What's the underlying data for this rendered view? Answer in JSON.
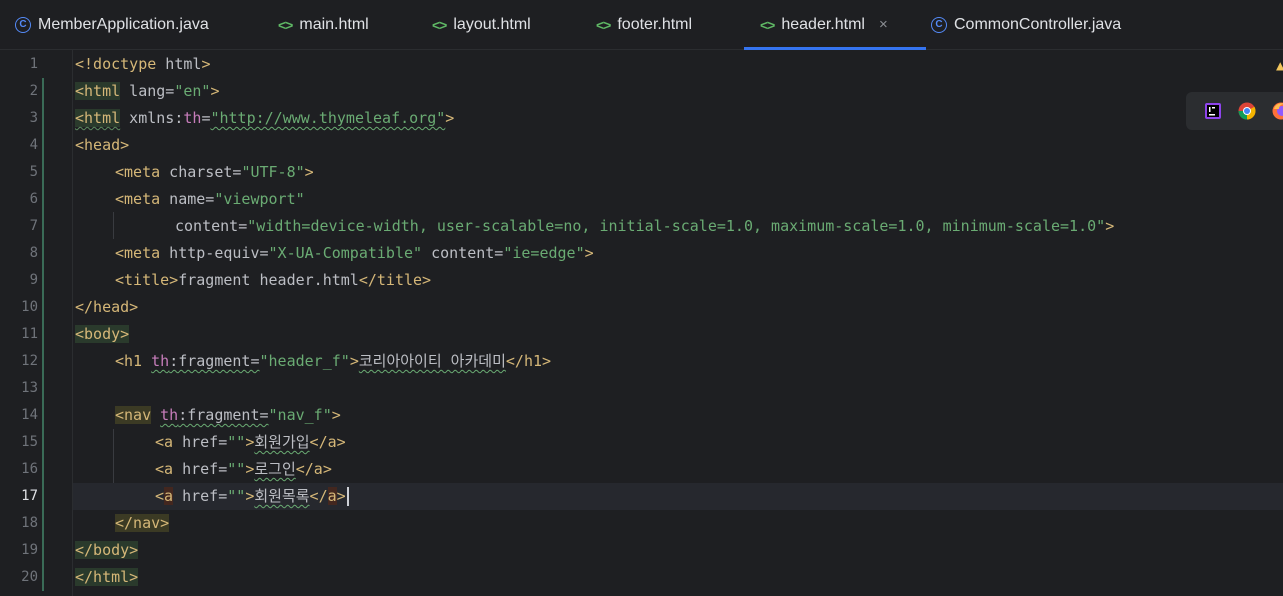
{
  "tabs": [
    {
      "label": "MemberApplication.java",
      "icon": "java-class-icon",
      "active": false
    },
    {
      "label": "main.html",
      "icon": "html-file-icon",
      "active": false
    },
    {
      "label": "layout.html",
      "icon": "html-file-icon",
      "active": false
    },
    {
      "label": "footer.html",
      "icon": "html-file-icon",
      "active": false
    },
    {
      "label": "header.html",
      "icon": "html-file-icon",
      "active": true
    },
    {
      "label": "CommonController.java",
      "icon": "java-class-icon",
      "active": false
    }
  ],
  "active_tab_close": "×",
  "line_numbers": [
    "1",
    "2",
    "3",
    "4",
    "5",
    "6",
    "7",
    "8",
    "9",
    "10",
    "11",
    "12",
    "13",
    "14",
    "15",
    "16",
    "17",
    "18",
    "19",
    "20"
  ],
  "current_line": "17",
  "code": {
    "l1": {
      "open": "<!doctype",
      "rest": " html",
      "close": ">"
    },
    "l2": {
      "tag": "<html",
      "attr": " lang=",
      "val": "\"en\"",
      "close": ">"
    },
    "l3": {
      "tag": "<html",
      "attr": " xmlns:",
      "ns": "th",
      "eq": "=",
      "val": "\"http://www.thymeleaf.org\"",
      "close": ">"
    },
    "l4": {
      "tag": "<head>"
    },
    "l5": {
      "tag": "<meta",
      "attr": " charset=",
      "val": "\"UTF-8\"",
      "close": ">"
    },
    "l6": {
      "tag": "<meta",
      "attr": " name=",
      "val": "\"viewport\""
    },
    "l7": {
      "attr": "content=",
      "val": "\"width=device-width, user-scalable=no, initial-scale=1.0, maximum-scale=1.0, minimum-scale=1.0\"",
      "close": ">"
    },
    "l8": {
      "tag": "<meta",
      "attr": " http-equiv=",
      "val": "\"X-UA-Compatible\"",
      "attr2": " content=",
      "val2": "\"ie=edge\"",
      "close": ">"
    },
    "l9": {
      "tag": "<title>",
      "text": "fragment header.html",
      "close": "</title>"
    },
    "l10": {
      "tag": "</head>"
    },
    "l11": {
      "tag": "<body>"
    },
    "l12": {
      "tag": "<h1",
      "ns": "th",
      "attr": ":fragment=",
      "val": "\"header_f\"",
      "gt": ">",
      "text": "코리아아이티 아카데미",
      "close": "</h1>"
    },
    "l14": {
      "tag": "<nav",
      "ns": "th",
      "attr": ":fragment=",
      "val": "\"nav_f\"",
      "close": ">"
    },
    "l15": {
      "tag": "<a",
      "attr": " href=",
      "val": "\"\"",
      "gt": ">",
      "text": "회원가입",
      "close": "</a>"
    },
    "l16": {
      "tag": "<a",
      "attr": " href=",
      "val": "\"\"",
      "gt": ">",
      "text": "로그인",
      "close": "</a>"
    },
    "l17": {
      "lt": "<",
      "tagname": "a",
      "attr": " href=",
      "val": "\"\"",
      "gt": ">",
      "text": "회원목록",
      "close_lt": "</",
      "close_name": "a",
      "close_gt": ">"
    },
    "l18": {
      "tag": "</nav>"
    },
    "l19": {
      "tag": "</body>"
    },
    "l20": {
      "tag": "</html>"
    }
  },
  "colors": {
    "background": "#1e1f22",
    "tag": "#d5b778",
    "string": "#6aab73",
    "namespace": "#c77dbb",
    "text": "#bcbec4",
    "active_tab_underline": "#3574f0"
  },
  "float_toolbar": {
    "icons": [
      "intellij-icon",
      "chrome-icon",
      "firefox-icon"
    ]
  }
}
